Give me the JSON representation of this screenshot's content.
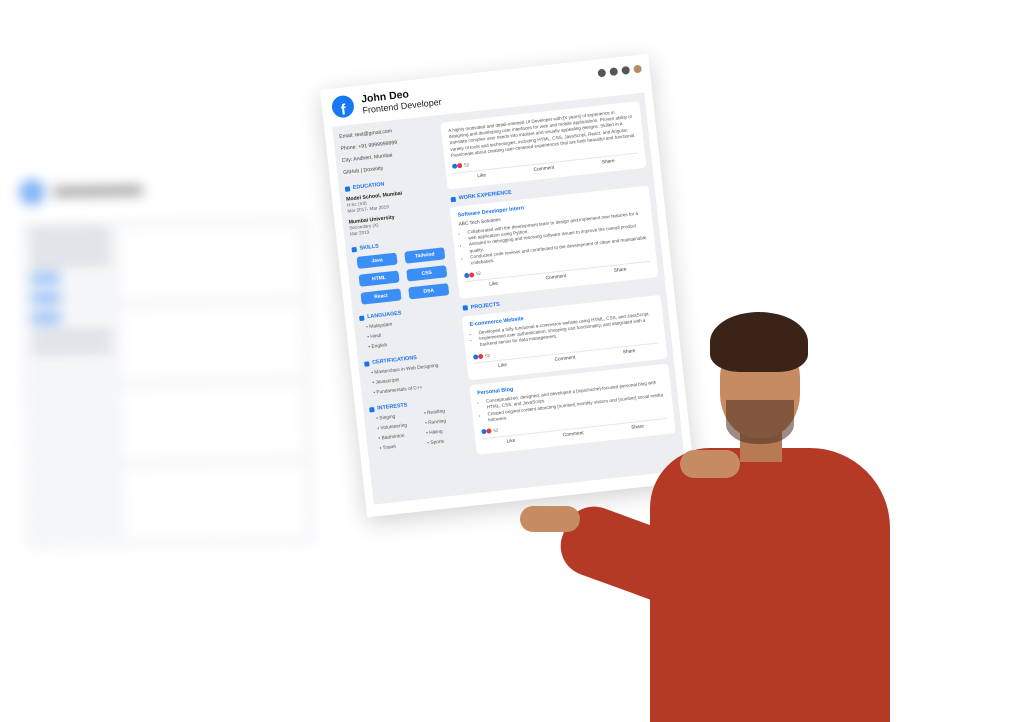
{
  "resume": {
    "name": "John Deo",
    "role": "Frontend Developer",
    "contact": {
      "email": "Email: test@gmail.com",
      "phone": "Phone: +91 9999999999",
      "city": "City: Andheri, Mumbai",
      "links": "GitHub | Doximity"
    },
    "education": {
      "title": "EDUCATION",
      "items": [
        {
          "school": "Model School, Mumbai",
          "degree": "H.Sc (XII)",
          "dates": "Mar 2017- Mar 2019"
        },
        {
          "school": "Mumbai University",
          "degree": "Secondary (X)",
          "dates": "Mar 2019"
        }
      ]
    },
    "skills": {
      "title": "SKILLS",
      "items": [
        "Java",
        "Tailwind",
        "HTML",
        "CSS",
        "React",
        "DSA"
      ]
    },
    "languages": {
      "title": "LANGUAGES",
      "items": [
        "Malayalam",
        "Hindi",
        "English"
      ]
    },
    "certifications": {
      "title": "CERTIFICATIONS",
      "items": [
        "Masterclass in Web Designing",
        "Javascripts",
        "Fundamentals of C++"
      ]
    },
    "interests": {
      "title": "INTERESTS",
      "items": [
        "Singing",
        "Reading",
        "Volunteering",
        "Running",
        "Badminton",
        "Hiking",
        "Travel",
        "Sports"
      ]
    },
    "summary": "A highly motivated and detail-oriented UI Developer with [X years] of experience in designing and developing user interfaces for web and mobile applications. Proven ability to translate complex user needs into intuitive and visually appealing designs. Skilled in a variety of tools and technologies, including HTML, CSS, JavaScript, React, and Angular. Passionate about creating user-centered experiences that are both beautiful and functional.",
    "reaction_count": "52",
    "actions": {
      "like": "Like",
      "comment": "Comment",
      "share": "Share"
    },
    "work": {
      "title": "WORK EXPERIENCE",
      "job_title": "Software Developer Intern",
      "company": "ABC Tech Solutions",
      "bullets": [
        "Collaborated with the development team to design and implement new features for a web application using Python.",
        "Assisted in debugging and resolving software issues to improve the overall product quality.",
        "Conducted code reviews and contributed to the development of clean and maintainable codebases."
      ]
    },
    "projects": {
      "title": "PROJECTS",
      "items": [
        {
          "title": "E-commerce Website",
          "bullets": [
            "Developed a fully functional e-commerce website using HTML, CSS, and JavaScript.",
            "Implemented user authentication, shopping cart functionality, and integrated with a backend server for data management."
          ]
        },
        {
          "title": "Personal Blog",
          "bullets": [
            "Conceptualized, designed, and developed a [topic/niche]-focused personal blog with HTML, CSS, and JavaScript.",
            "Created original content attracting [number] monthly visitors and [number] social media followers."
          ]
        }
      ]
    }
  },
  "colors": {
    "accent": "#1a73e8",
    "chip": "#3b8ef5",
    "sweater": "#b53a26",
    "brand": "#1877f2"
  }
}
